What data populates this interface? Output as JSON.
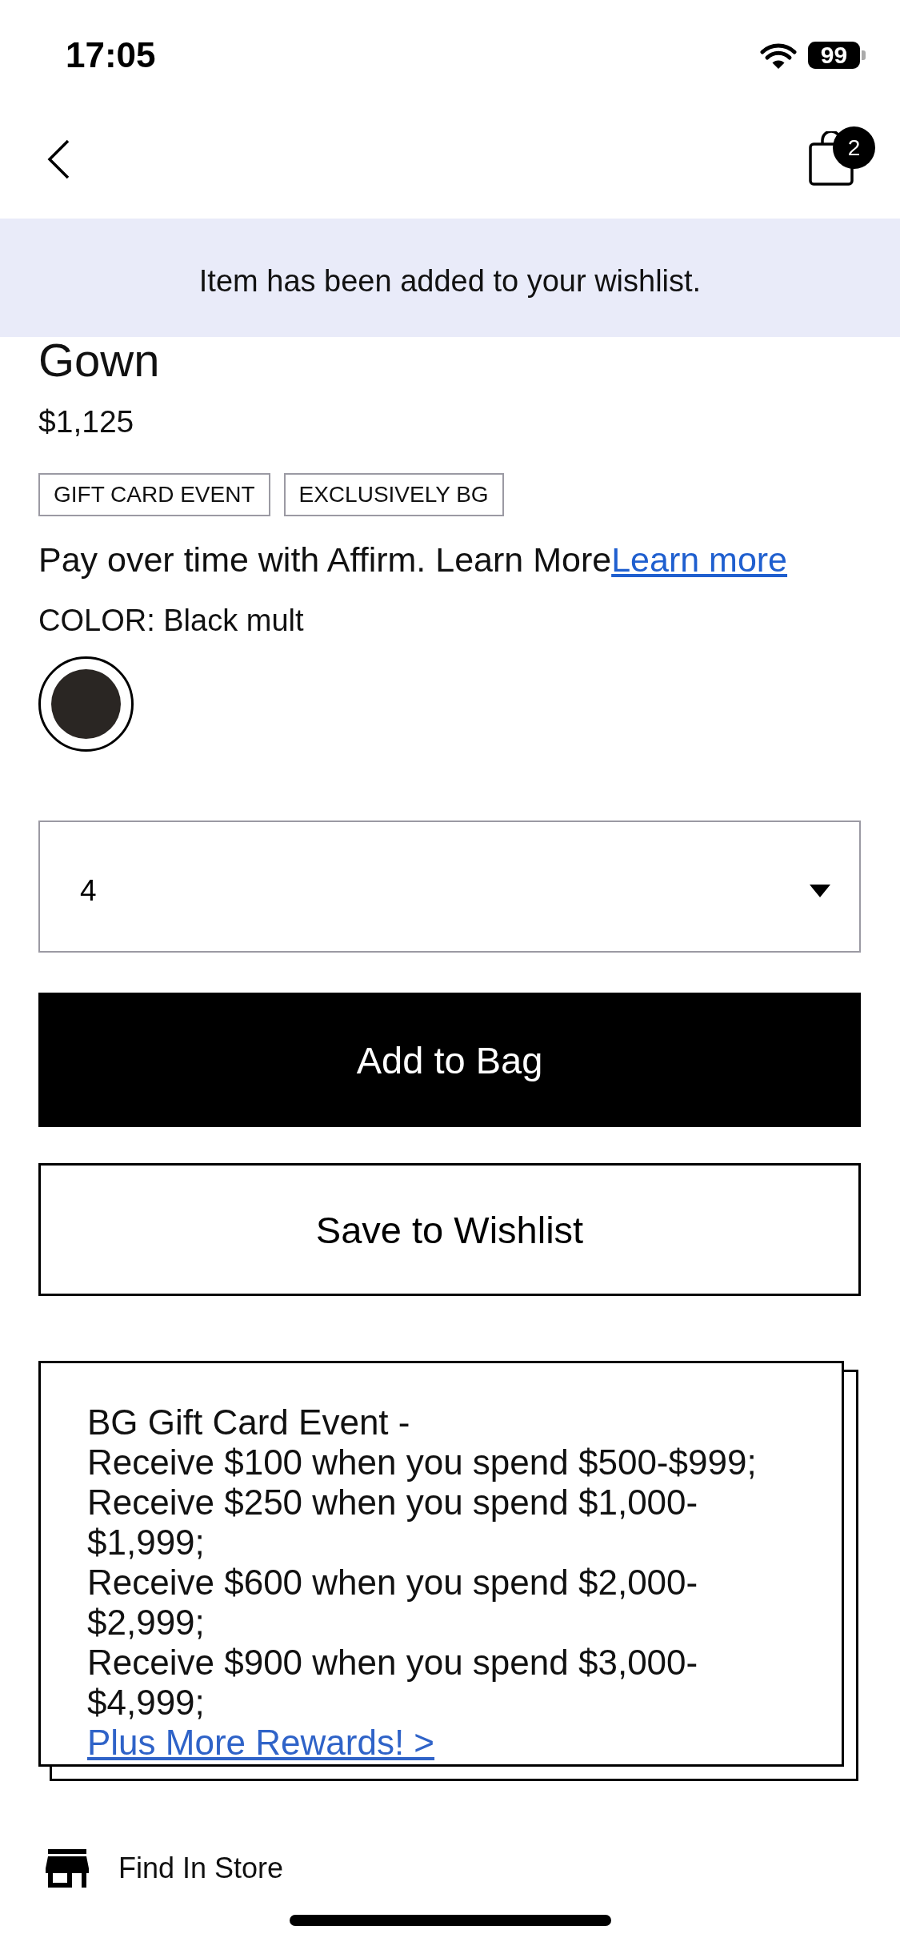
{
  "status_bar": {
    "time": "17:05",
    "battery": "99"
  },
  "nav_bar": {
    "cart_count": "2"
  },
  "notice": {
    "message": "Item has been added to your wishlist."
  },
  "product": {
    "name": "Gown",
    "price": "$1,125",
    "tags": [
      "GIFT CARD EVENT",
      "EXCLUSIVELY BG"
    ],
    "financing": {
      "text": "Pay over time with Affirm. Learn More",
      "link": "Learn more"
    },
    "color": {
      "label": "COLOR:",
      "value": "Black mult",
      "swatches": [
        {
          "color": "#2a2623",
          "selected": true
        }
      ]
    },
    "size_select": {
      "value": "4"
    }
  },
  "actions": [
    {
      "kind": "primary",
      "label": "Add to Bag"
    },
    {
      "kind": "secondary",
      "label": "Save to Wishlist"
    }
  ],
  "promo": {
    "title": "BG Gift Card Event -",
    "tiers": [
      "Receive $100 when you spend $500-$999;",
      "Receive $250 when you spend $1,000-$1,999;",
      "Receive $600 when you spend $2,000-$2,999;",
      "Receive $900 when you spend $3,000-$4,999;"
    ],
    "link": "Plus More Rewards! >"
  },
  "find_in_store": {
    "label": "Find In Store"
  }
}
